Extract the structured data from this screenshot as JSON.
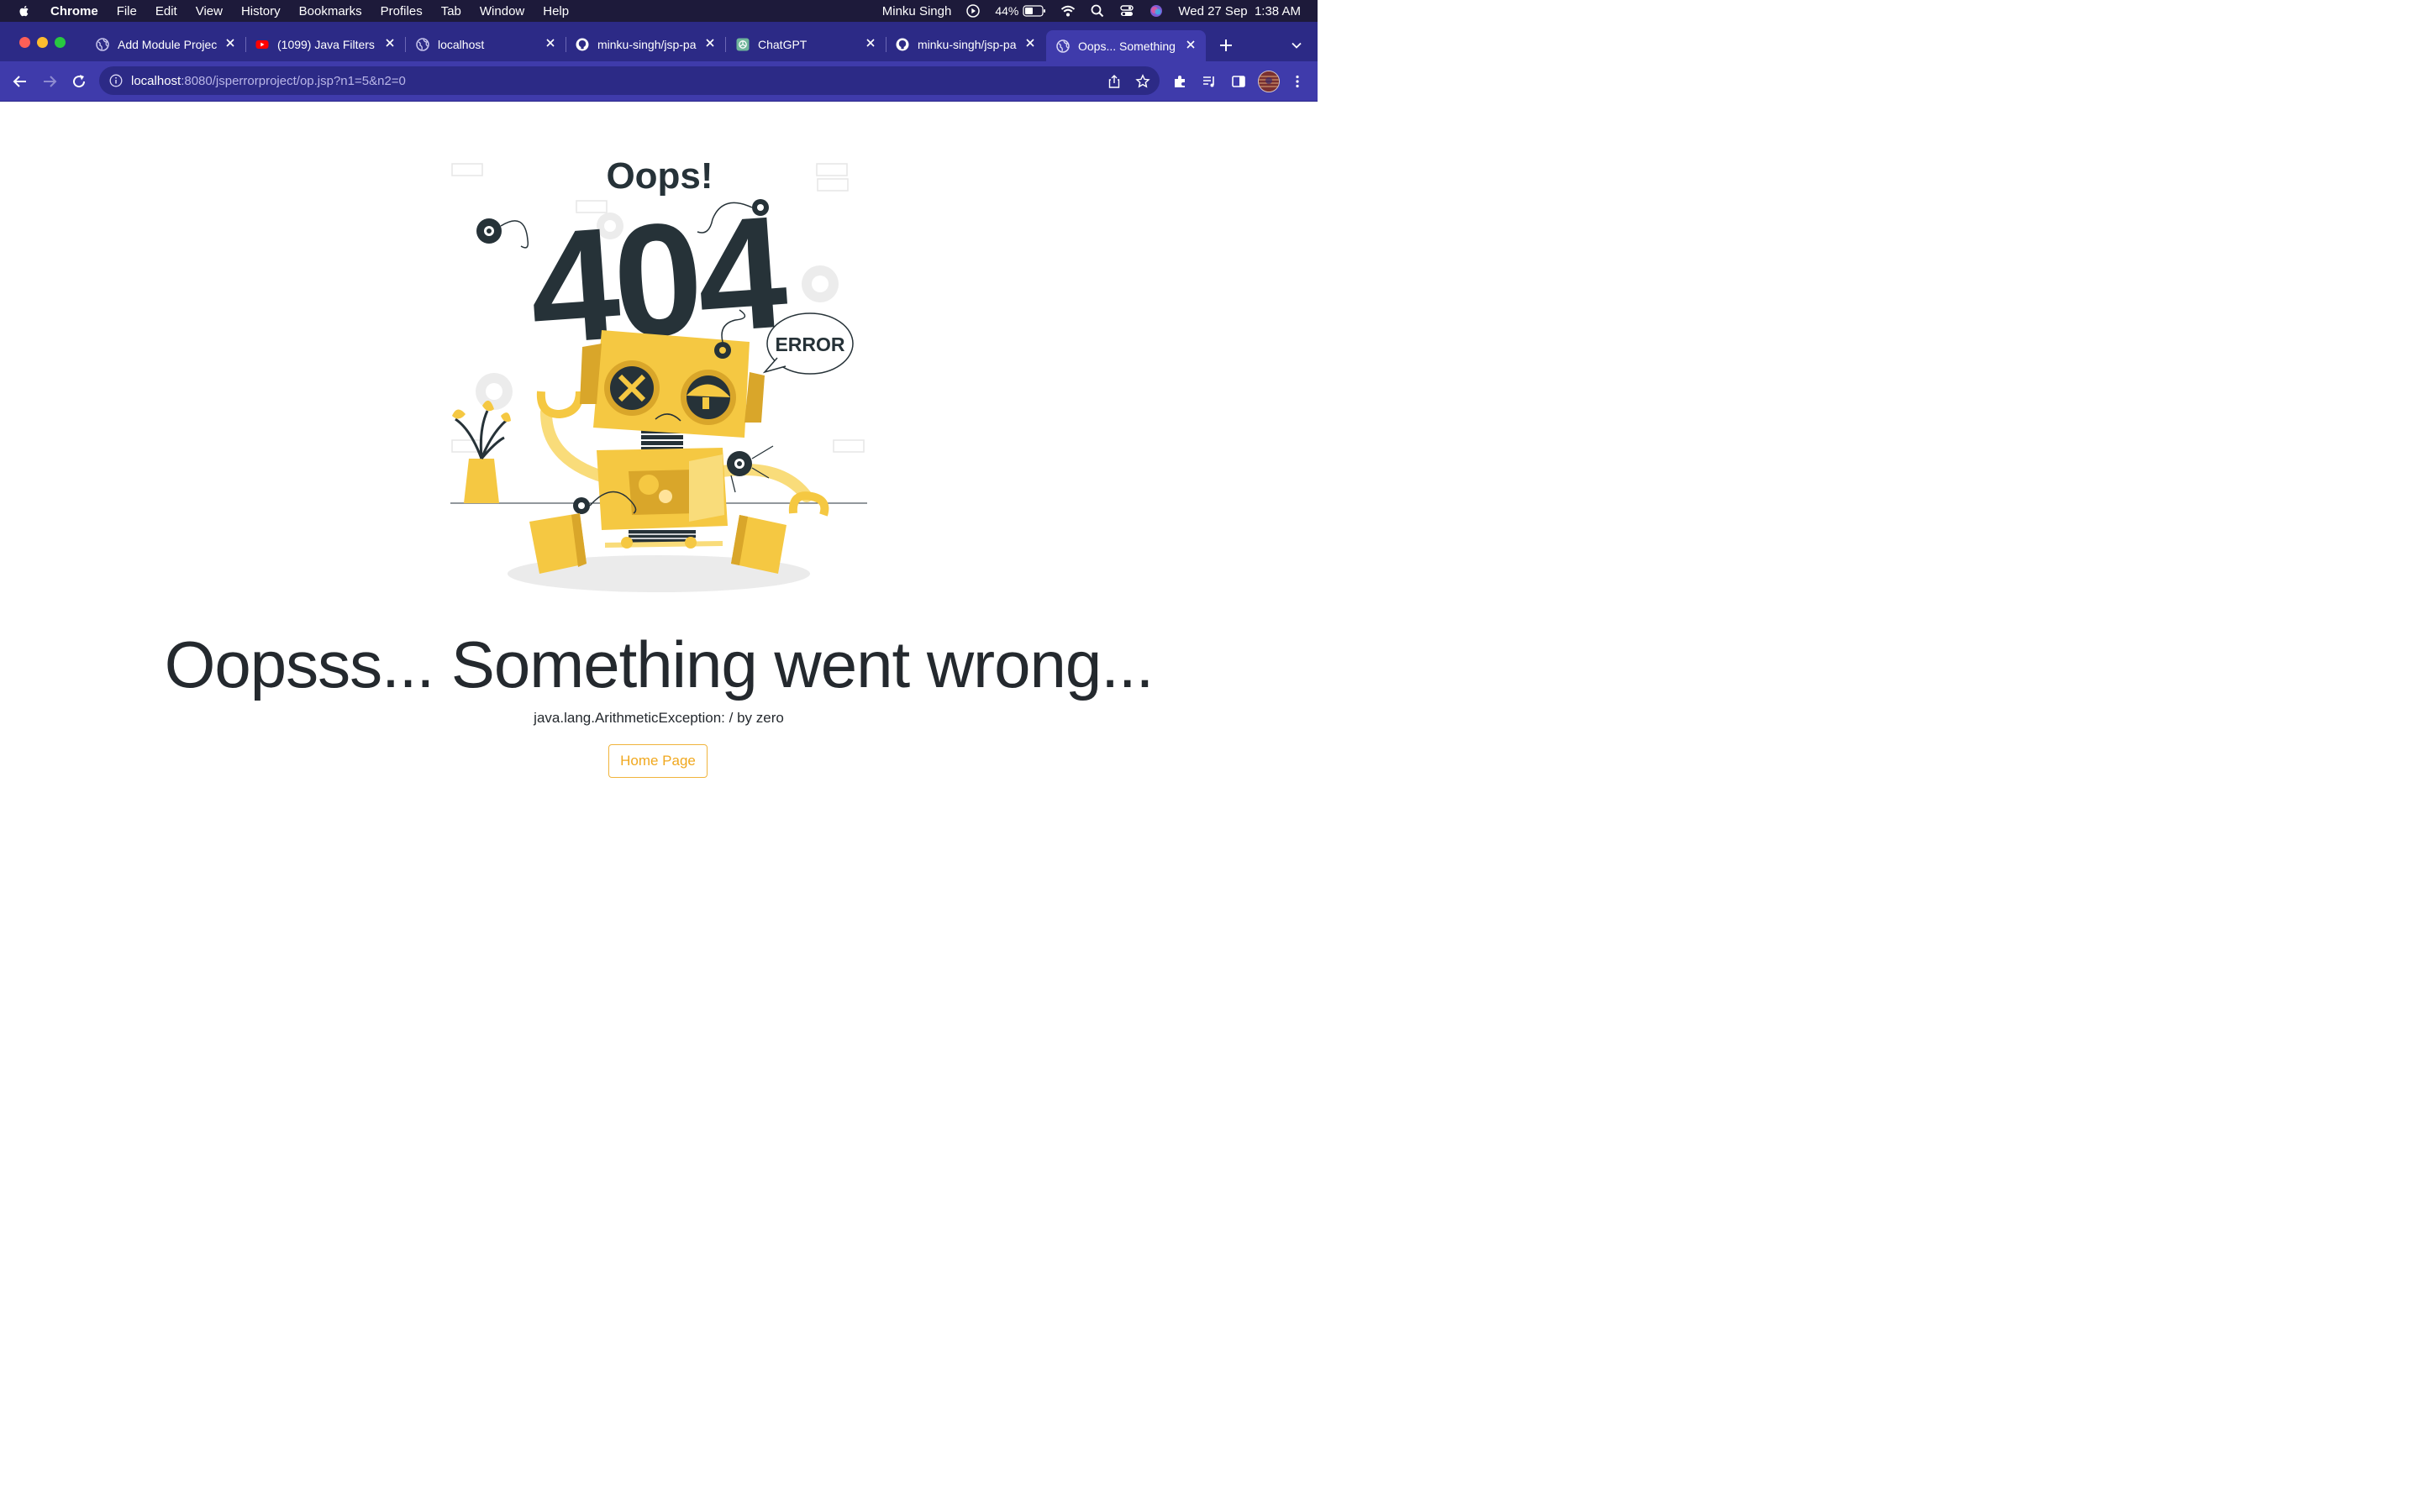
{
  "menubar": {
    "app_name": "Chrome",
    "items": [
      "File",
      "Edit",
      "View",
      "History",
      "Bookmarks",
      "Profiles",
      "Tab",
      "Window",
      "Help"
    ],
    "user": "Minku Singh",
    "battery": "44%",
    "datetime": "Wed 27 Sep  1:38 AM"
  },
  "tabs": [
    {
      "title": "Add Module Projec",
      "icon": "globe-icon",
      "active": false
    },
    {
      "title": "(1099) Java Filters",
      "icon": "youtube-icon",
      "active": false
    },
    {
      "title": "localhost",
      "icon": "globe-icon",
      "active": false
    },
    {
      "title": "minku-singh/jsp-pa",
      "icon": "github-icon",
      "active": false
    },
    {
      "title": "ChatGPT",
      "icon": "chatgpt-icon",
      "active": false
    },
    {
      "title": "minku-singh/jsp-pa",
      "icon": "github-icon",
      "active": false
    },
    {
      "title": "Oops... Something",
      "icon": "globe-icon",
      "active": true
    }
  ],
  "address_bar": {
    "host": "localhost",
    "path": ":8080/jsperrorproject/op.jsp?n1=5&n2=0"
  },
  "illustration": {
    "oops_text": "Oops!",
    "code_text": "404",
    "bubble_text": "ERROR"
  },
  "page": {
    "headline": "Oopsss... Something went wrong...",
    "error_message": "java.lang.ArithmeticException: / by zero",
    "home_button": "Home Page"
  },
  "colors": {
    "menubar_bg": "#1d1a3a",
    "tabstrip_bg": "#2c2a86",
    "toolbar_bg": "#3f3bab",
    "robot_yellow": "#f5c842",
    "dark_text": "#24292e",
    "button_accent": "#f0a81f"
  }
}
